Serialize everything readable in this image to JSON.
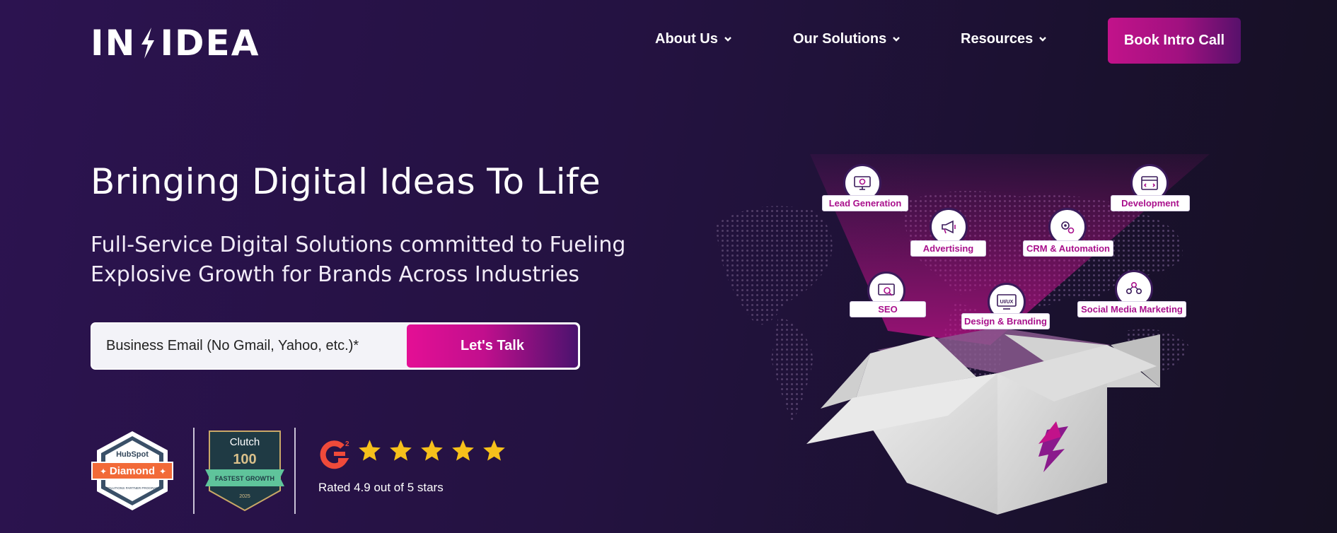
{
  "brand": {
    "logo_left": "IN",
    "logo_right": "IDEA"
  },
  "nav": [
    {
      "label": "About Us"
    },
    {
      "label": "Our Solutions"
    },
    {
      "label": "Resources"
    }
  ],
  "header": {
    "cta_label": "Book Intro Call"
  },
  "hero": {
    "title": "Bringing Digital Ideas To Life",
    "subtitle": "Full-Service Digital Solutions committed to Fueling Explosive Growth for Brands Across Industries",
    "email_placeholder": "Business Email (No Gmail, Yahoo, etc.)*",
    "submit_label": "Let's Talk"
  },
  "badges": {
    "hubspot": {
      "brand": "HubSpot",
      "tier": "Diamond",
      "program": "SOLUTIONS PARTNER PROGRAM"
    },
    "clutch": {
      "brand": "Clutch",
      "number": "100",
      "ribbon": "FASTEST GROWTH",
      "year": "2025"
    },
    "g2": {
      "logo": "G2",
      "rating": 4.9,
      "stars": 5,
      "rating_text": "Rated 4.9 out of 5 stars"
    }
  },
  "services": [
    {
      "label": "Lead Generation",
      "icon": "monitor-gear-icon"
    },
    {
      "label": "Development",
      "icon": "browser-code-icon"
    },
    {
      "label": "Advertising",
      "icon": "megaphone-icon"
    },
    {
      "label": "CRM & Automation",
      "icon": "gears-icon"
    },
    {
      "label": "SEO",
      "icon": "seo-chart-icon"
    },
    {
      "label": "Design & Branding",
      "icon": "ui-ux-monitor-icon"
    },
    {
      "label": "Social Media Marketing",
      "icon": "social-network-icon"
    }
  ],
  "ui_ux_text": "UI/UX",
  "colors": {
    "accent": "#c2128a",
    "accent_dark": "#57116b",
    "background": "#2c1350",
    "star": "#f6c01b"
  }
}
